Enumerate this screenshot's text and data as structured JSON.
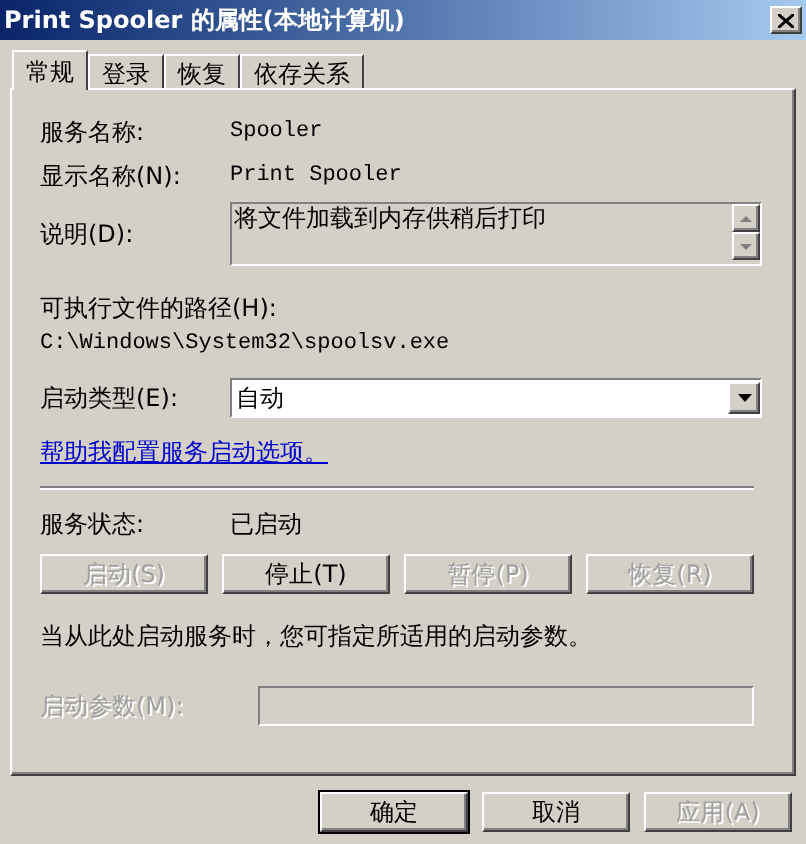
{
  "window": {
    "title": "Print Spooler 的属性(本地计算机)"
  },
  "tabs": [
    {
      "label": "常规",
      "selected": true
    },
    {
      "label": "登录",
      "selected": false
    },
    {
      "label": "恢复",
      "selected": false
    },
    {
      "label": "依存关系",
      "selected": false
    }
  ],
  "service_name": {
    "label": "服务名称:",
    "value": "Spooler"
  },
  "display_name": {
    "label": "显示名称(N):",
    "value": "Print Spooler"
  },
  "description": {
    "label": "说明(D):",
    "value": "将文件加载到内存供稍后打印"
  },
  "path": {
    "label": "可执行文件的路径(H):",
    "value": "C:\\Windows\\System32\\spoolsv.exe"
  },
  "startup_type": {
    "label": "启动类型(E):",
    "value": "自动"
  },
  "help_link": "帮助我配置服务启动选项。",
  "service_status": {
    "label": "服务状态:",
    "value": "已启动"
  },
  "control_buttons": [
    {
      "label": "启动(S)",
      "disabled": true
    },
    {
      "label": "停止(T)",
      "disabled": false
    },
    {
      "label": "暂停(P)",
      "disabled": true
    },
    {
      "label": "恢复(R)",
      "disabled": true
    }
  ],
  "hint": "当从此处启动服务时，您可指定所适用的启动参数。",
  "start_params": {
    "label": "启动参数(M):",
    "disabled": true
  },
  "footer_buttons": [
    {
      "label": "确定",
      "disabled": false,
      "default": true
    },
    {
      "label": "取消",
      "disabled": false,
      "default": false
    },
    {
      "label": "应用(A)",
      "disabled": true,
      "default": false
    }
  ]
}
